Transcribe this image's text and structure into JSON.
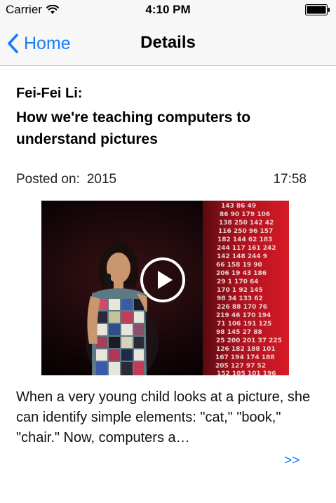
{
  "status_bar": {
    "carrier": "Carrier",
    "time": "4:10 PM"
  },
  "nav": {
    "back_label": "Home",
    "title": "Details"
  },
  "talk": {
    "author": "Fei-Fei Li:",
    "title": "How we're teaching computers to understand pictures",
    "posted_label": "Posted on:",
    "year": "2015",
    "duration": "17:58",
    "description": "When a very young child looks at a picture, she can identify simple elements: \"cat,\" \"book,\" \"chair.\" Now, computers a…",
    "more_label": ">>"
  },
  "colors": {
    "accent": "#1a7cf2",
    "bar_background": "#f7f7f8",
    "video_numbers": "#e8e8e8"
  },
  "icons": {
    "wifi": "wifi-icon",
    "battery": "battery-icon",
    "back": "chevron-left-icon",
    "play": "play-icon"
  }
}
